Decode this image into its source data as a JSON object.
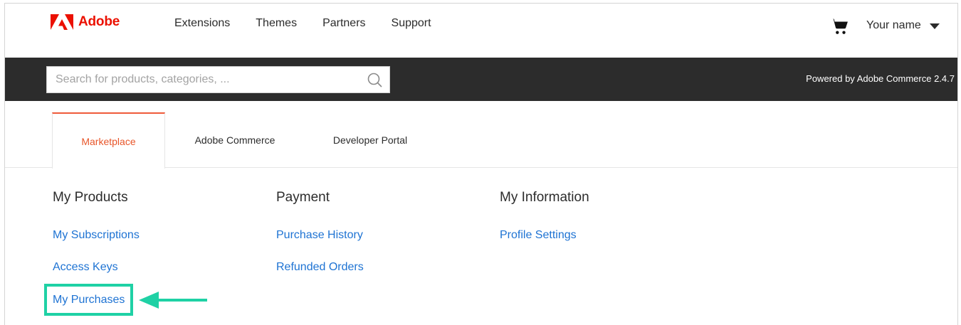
{
  "brand": {
    "name": "Adobe",
    "color": "#eb1000",
    "icon": "adobe-logo-icon"
  },
  "nav": {
    "links": [
      "Extensions",
      "Themes",
      "Partners",
      "Support"
    ],
    "user_name": "Your name"
  },
  "search": {
    "placeholder": "Search for products, categories, ...",
    "value": ""
  },
  "powered_by": "Powered by Adobe Commerce 2.4.7",
  "tabs": [
    {
      "label": "Marketplace",
      "active": true
    },
    {
      "label": "Adobe Commerce",
      "active": false
    },
    {
      "label": "Developer Portal",
      "active": false
    }
  ],
  "sections": [
    {
      "title": "My Products",
      "links": [
        "My Subscriptions",
        "Access Keys",
        "My Purchases"
      ]
    },
    {
      "title": "Payment",
      "links": [
        "Purchase History",
        "Refunded Orders"
      ]
    },
    {
      "title": "My Information",
      "links": [
        "Profile Settings"
      ]
    }
  ],
  "colors": {
    "accent_tab": "#ef5a3a",
    "link": "#1e73d3",
    "highlight": "#1fd1a5",
    "dark_bar": "#2c2c2c"
  }
}
